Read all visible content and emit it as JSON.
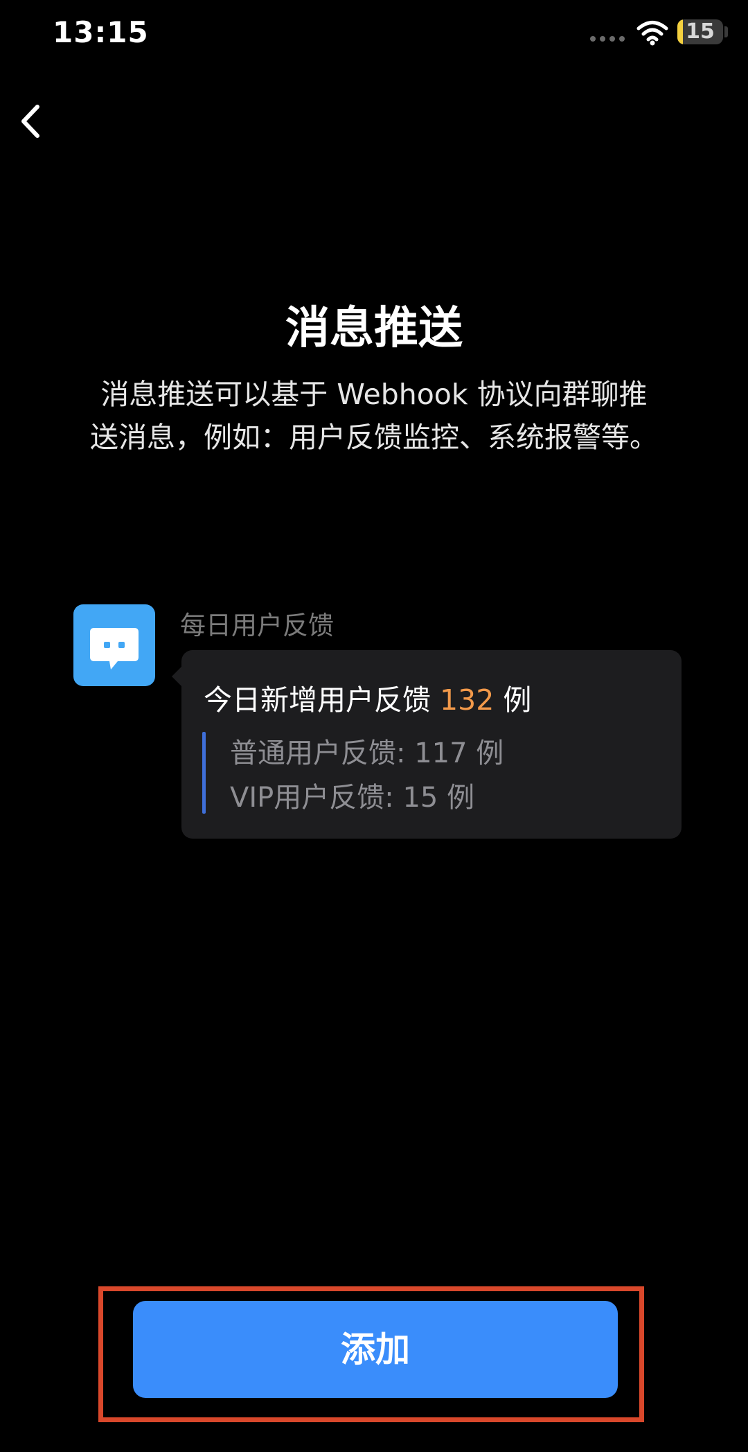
{
  "status_bar": {
    "time": "13:15",
    "battery_level": "15",
    "icons": [
      "signal-dots-icon",
      "wifi-icon",
      "battery-icon"
    ]
  },
  "nav": {
    "back_icon": "chevron-left-icon"
  },
  "page": {
    "title": "消息推送",
    "description": "消息推送可以基于 Webhook 协议向群聊推送消息，例如：用户反馈监控、系统报警等。"
  },
  "preview": {
    "bot_icon": "chat-bubble-icon",
    "bot_color": "#42a7f5",
    "sender_name": "每日用户反馈",
    "message": {
      "title_prefix": "今日新增用户反馈 ",
      "title_count": "132",
      "title_suffix": " 例",
      "count_color": "#f2994a",
      "lines": [
        "普通用户反馈: 117 例",
        "VIP用户反馈: 15 例"
      ]
    }
  },
  "actions": {
    "add_label": "添加",
    "add_color": "#3a8dfb",
    "highlight_color": "#d9482b"
  }
}
